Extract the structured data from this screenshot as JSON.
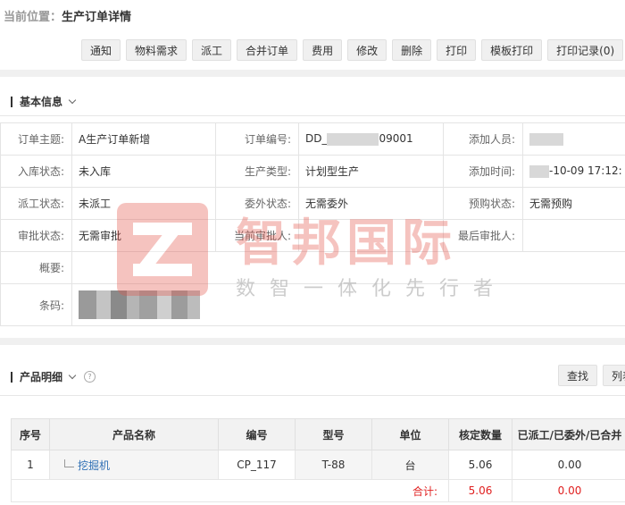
{
  "breadcrumb": {
    "prefix": "当前位置：",
    "title": "生产订单详情"
  },
  "toolbar": [
    "通知",
    "物料需求",
    "派工",
    "合并订单",
    "费用",
    "修改",
    "删除",
    "打印",
    "模板打印",
    "打印记录(0)"
  ],
  "basic": {
    "section_title": "基本信息",
    "fields": {
      "subject_label": "订单主题:",
      "subject": "A生产订单新增",
      "order_no_label": "订单编号:",
      "order_no_prefix": "DD_",
      "order_no_suffix": "09001",
      "adder_label": "添加人员:",
      "stock_label": "入库状态:",
      "stock": "未入库",
      "ptype_label": "生产类型:",
      "ptype": "计划型生产",
      "addtime_label": "添加时间:",
      "addtime_suffix": "-10-09 17:12:",
      "dispatch_label": "派工状态:",
      "dispatch": "未派工",
      "outsource_label": "委外状态:",
      "outsource": "无需委外",
      "purchase_label": "预购状态:",
      "purchase": "无需预购",
      "approve_label": "审批状态:",
      "approve": "无需审批",
      "cur_approver_label": "当前审批人:",
      "last_approver_label": "最后审批人:",
      "summary_label": "概要:",
      "barcode_label": "条码:"
    }
  },
  "product": {
    "section_title": "产品明细",
    "buttons": [
      "查找",
      "列表"
    ],
    "columns": [
      "序号",
      "产品名称",
      "编号",
      "型号",
      "单位",
      "核定数量",
      "已派工/已委外/已合并"
    ],
    "rows": [
      {
        "index": "1",
        "name": "挖掘机",
        "code": "CP_117",
        "model": "T-88",
        "unit": "台",
        "qty": "5.06",
        "done": "0.00"
      }
    ],
    "total_label": "合计:",
    "total_qty": "5.06",
    "total_done": "0.00"
  },
  "watermark": {
    "brand": "智邦国际",
    "slogan": "数智一体化先行者"
  },
  "colors": {
    "accent_red": "#e02020",
    "link_blue": "#2f6fb5",
    "watermark_red": "#e5554b"
  }
}
